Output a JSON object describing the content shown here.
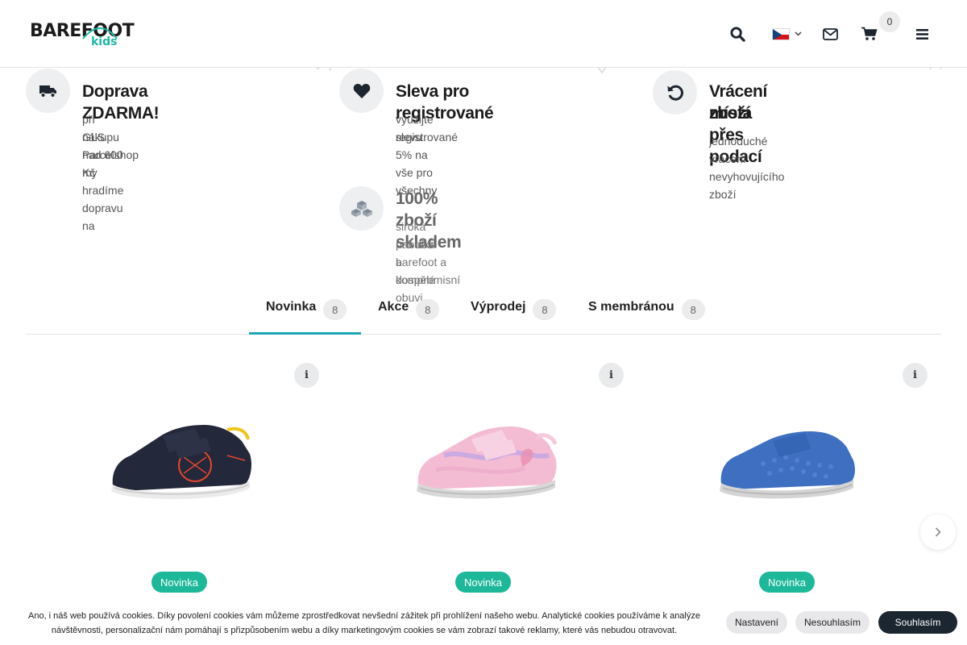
{
  "header": {
    "logo_text_a": "BAREF",
    "logo_text_b": "OOT",
    "logo_sub": "kids",
    "cart_count": "0",
    "language": "cs"
  },
  "benefits": [
    {
      "icon": "truck-icon",
      "title": "Doprava ZDARMA!",
      "desc_line1": "při nákupu nad 600 Kč hradíme dopravu na",
      "desc_line2": "GLS Parcelshop my"
    },
    {
      "icon": "heart-icon",
      "title": "Sleva pro registrované",
      "desc_line1": "využijte slevu 5% na vše pro všechny",
      "desc_line2": "registrované"
    },
    {
      "icon": "undo-icon",
      "title_line1": "Vrácení zboží přes podací",
      "title_line2": "místa",
      "desc_line1": "jednoduché vrácení nevyhovujícího zboží"
    },
    {
      "icon": "cubes-icon",
      "title": "100% zboží skladem",
      "desc_line1": "široká nabídka barefoot a kompromisní obuvi",
      "desc_line2": "pro děti a dospělé"
    }
  ],
  "tabs": [
    {
      "label": "Novinka",
      "count": "8",
      "active": true
    },
    {
      "label": "Akce",
      "count": "8",
      "active": false
    },
    {
      "label": "Výprodej",
      "count": "8",
      "active": false
    },
    {
      "label": "S membránou",
      "count": "8",
      "active": false
    }
  ],
  "products": [
    {
      "badge": "Novinka",
      "info": "i",
      "colors": {
        "upper": "#23283a",
        "accent": "#e8452f",
        "strap": "#f0c419",
        "sole": "#e9e9e9"
      }
    },
    {
      "badge": "Novinka",
      "info": "i",
      "colors": {
        "upper": "#f3b9d2",
        "accent": "#b9a3e8",
        "strap": "#f7c9dc",
        "sole": "#d5d5d5"
      }
    },
    {
      "badge": "Novinka",
      "info": "i",
      "colors": {
        "upper": "#3f6fc1",
        "accent": "#5f8cd8",
        "strap": "#3565b5",
        "sole": "#d2d2d2"
      }
    }
  ],
  "cookie": {
    "line1": "Ano, i náš web používá cookies. Díky povolení cookies vám můžeme zprostředkovat nevšední zážitek při prohlížení našeho webu. Analytické cookies používáme k analýze",
    "line2": "návštěvnosti, personalizační nám pomáhají s přizpůsobením webu a díky marketingovým cookies se vám zobrazí takové reklamy, které vás nebudou otravovat.",
    "settings": "Nastavení",
    "decline": "Nesouhlasím",
    "accept": "Souhlasím"
  },
  "colors": {
    "accent": "#1fa7b8",
    "badge": "#1db89a",
    "dark": "#1b2630"
  }
}
